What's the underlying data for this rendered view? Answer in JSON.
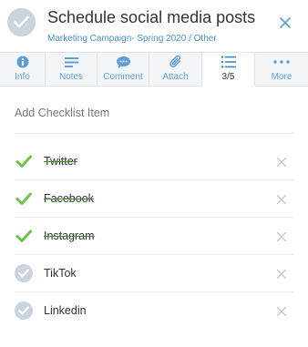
{
  "header": {
    "title": "Schedule social media posts",
    "breadcrumb": "Marketing Campaign- Spring 2020 / Other"
  },
  "tabs": [
    {
      "label": "Info",
      "icon": "info-icon",
      "active": false
    },
    {
      "label": "Notes",
      "icon": "notes-icon",
      "active": false
    },
    {
      "label": "Comment",
      "icon": "comment-icon",
      "active": false
    },
    {
      "label": "Attach",
      "icon": "paperclip-icon",
      "active": false
    },
    {
      "label": "3/5",
      "icon": "checklist-icon",
      "active": true
    },
    {
      "label": "More",
      "icon": "more-icon",
      "active": false
    }
  ],
  "checklist": {
    "add_placeholder": "Add Checklist Item",
    "items": [
      {
        "label": "Twitter",
        "done": true
      },
      {
        "label": "Facebook",
        "done": true
      },
      {
        "label": "Instagram",
        "done": true
      },
      {
        "label": "TikTok",
        "done": false
      },
      {
        "label": "Linkedin",
        "done": false
      }
    ]
  },
  "colors": {
    "accent": "#4a90c8",
    "done_check": "#6fc34a",
    "pending_check": "#c9d4df"
  }
}
